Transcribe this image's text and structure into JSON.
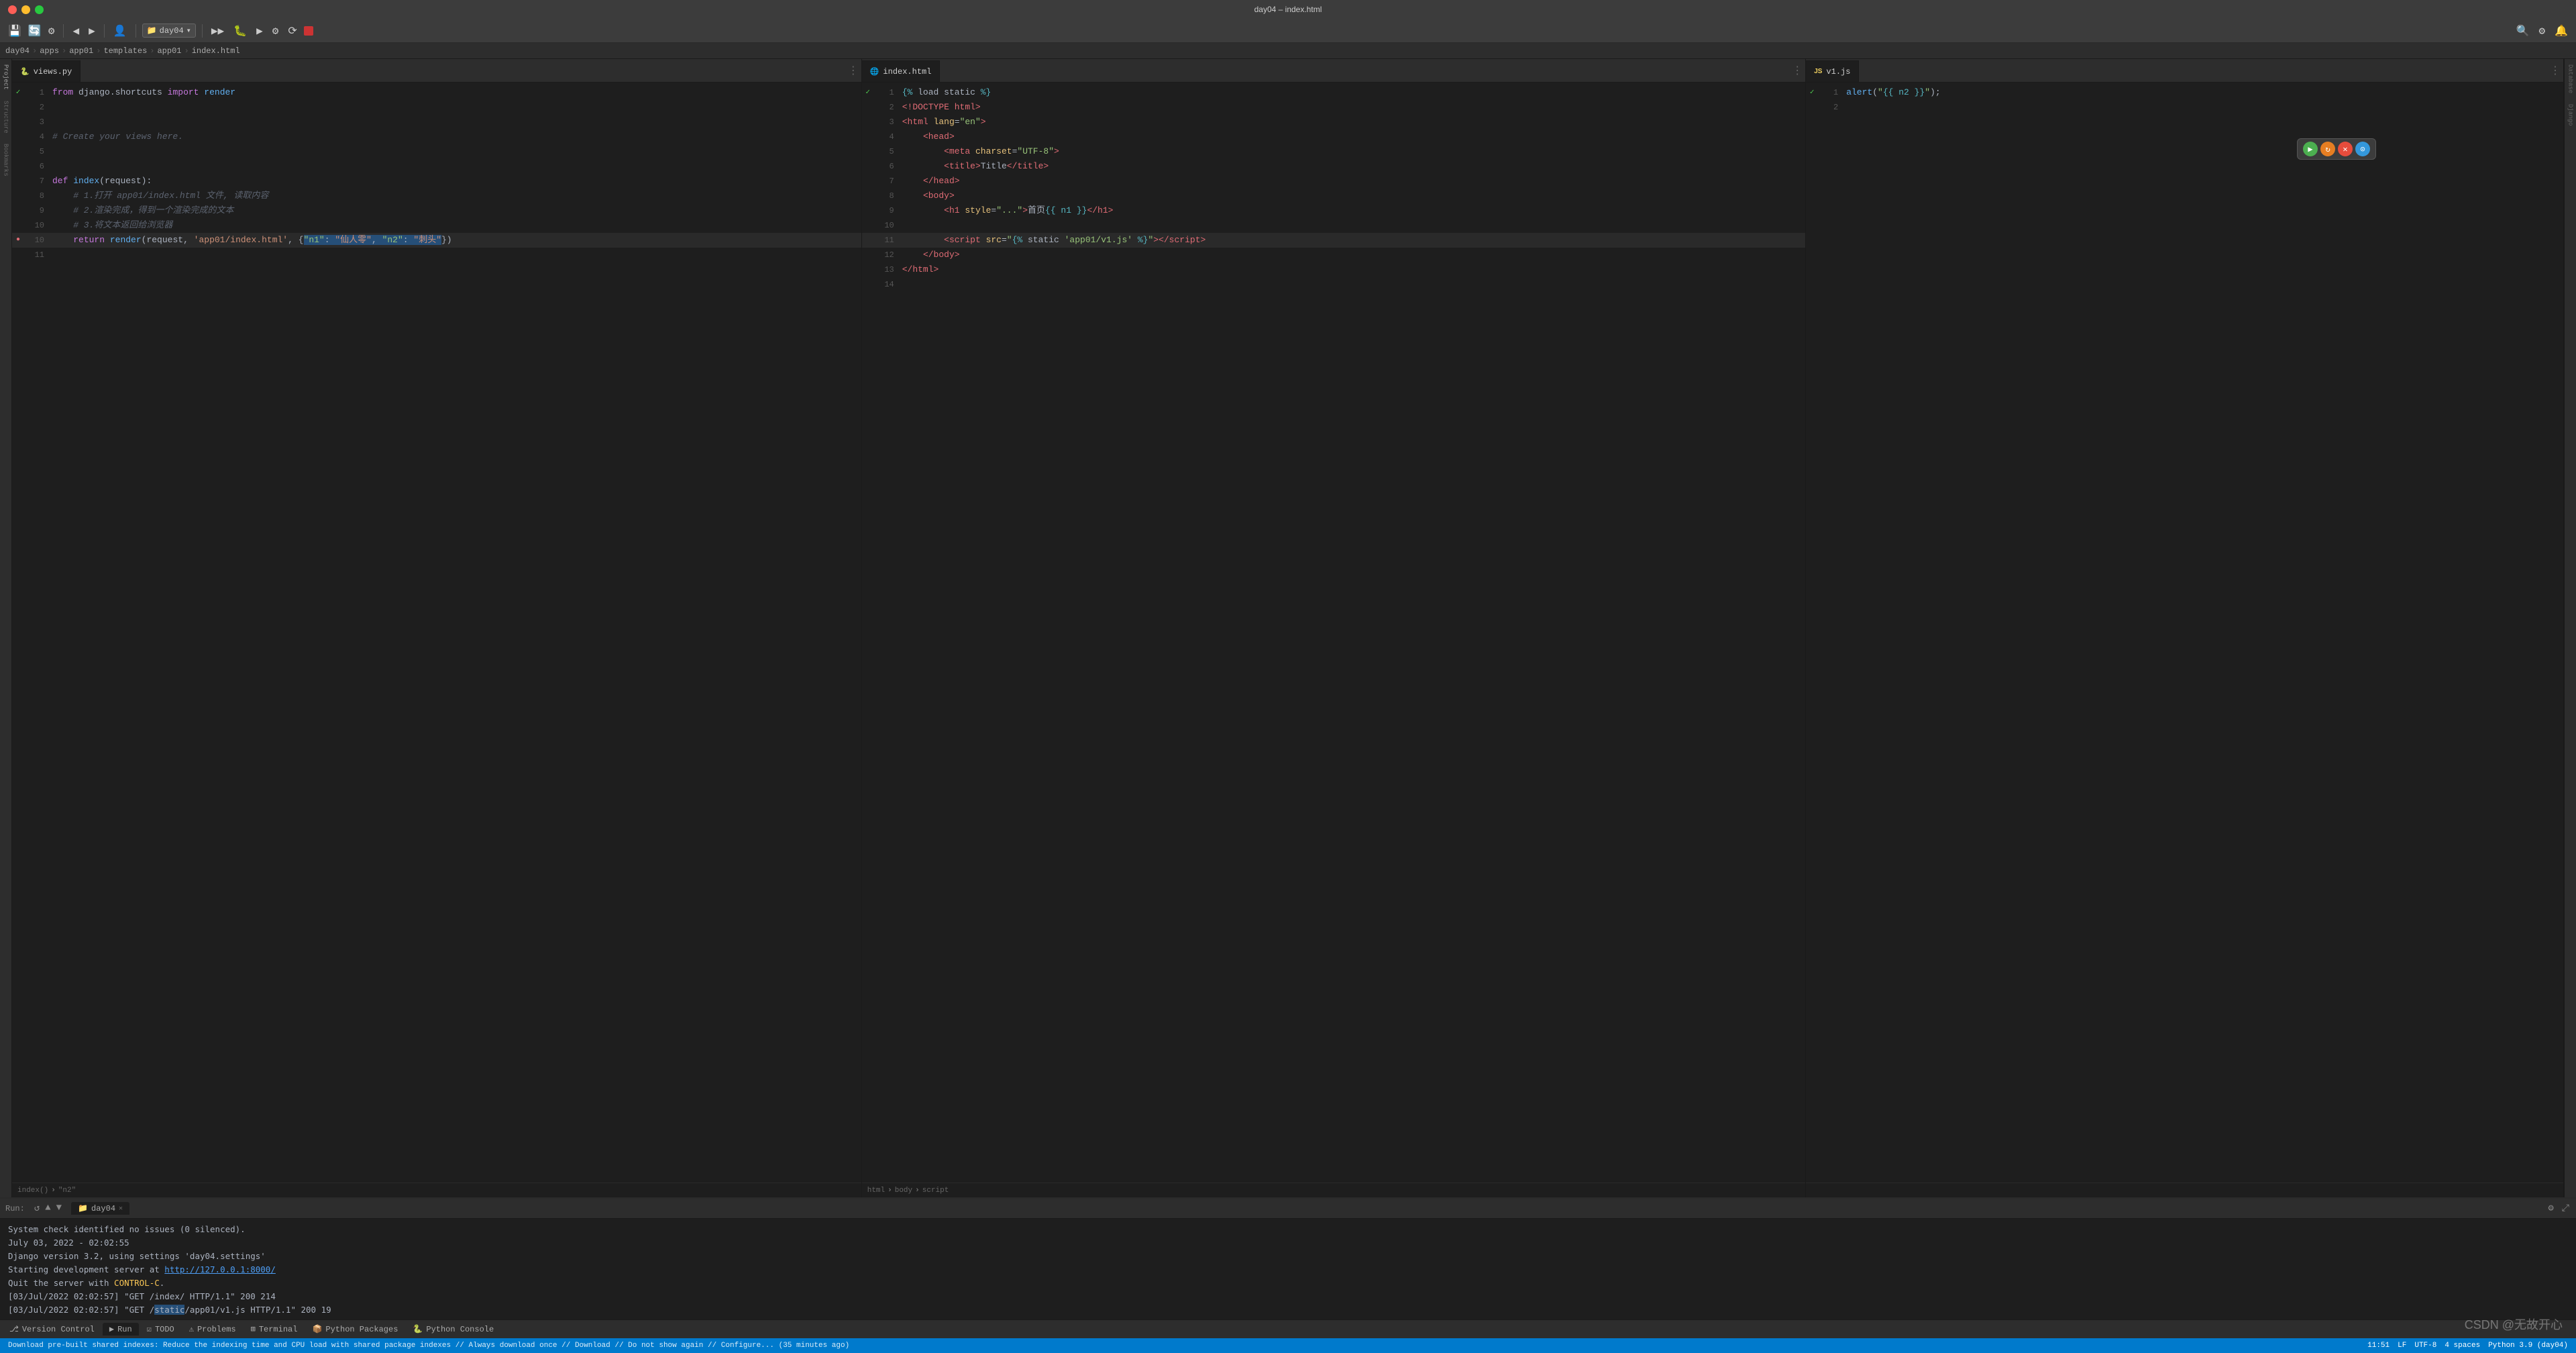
{
  "window": {
    "title": "day04 – index.html"
  },
  "toolbar": {
    "project_name": "day04",
    "run_btn": "▶",
    "stop_color": "#cc3333"
  },
  "breadcrumb": {
    "items": [
      "day04",
      "apps",
      "app01",
      "templates",
      "app01",
      "index.html"
    ]
  },
  "left_panel": {
    "tab": {
      "filename": "views.py",
      "icon": "🐍"
    },
    "lines": [
      {
        "num": 1,
        "content": "from django.shortcuts import render",
        "has_check": true
      },
      {
        "num": 2,
        "content": ""
      },
      {
        "num": 3,
        "content": ""
      },
      {
        "num": 4,
        "content": "# Create your views here."
      },
      {
        "num": 5,
        "content": ""
      },
      {
        "num": 6,
        "content": ""
      },
      {
        "num": 7,
        "content": "def index(request):"
      },
      {
        "num": 8,
        "content": "    # 1.打开 app01/index.html 文件, 读取内容"
      },
      {
        "num": 9,
        "content": "    # 2.渲染完成，得到一个渲染完成的文本"
      },
      {
        "num": 10,
        "content": "    # 3.将文本返回给浏览器"
      },
      {
        "num": 11,
        "content": "    return render(request, 'app01/index.html', {\"n1\": \"仙人零\", \"n2\": \"刺头\"})",
        "is_highlighted": true,
        "has_debug_icon": true
      }
    ],
    "status": [
      "index()",
      "\"n2\""
    ]
  },
  "middle_panel": {
    "tab": {
      "filename": "index.html",
      "icon": "🌐"
    },
    "lines": [
      {
        "num": 1,
        "content": "{% load static %}",
        "has_check": true
      },
      {
        "num": 2,
        "content": "<!DOCTYPE html>"
      },
      {
        "num": 3,
        "content": "<html lang=\"en\">"
      },
      {
        "num": 4,
        "content": "    <head>"
      },
      {
        "num": 5,
        "content": "        <meta charset=\"UTF-8\">"
      },
      {
        "num": 6,
        "content": "        <title>Title</title>"
      },
      {
        "num": 7,
        "content": "    </head>"
      },
      {
        "num": 8,
        "content": "    <body>"
      },
      {
        "num": 9,
        "content": "        <h1 style=\"...\">首页{{ n1 }}</h1>"
      },
      {
        "num": 10,
        "content": ""
      },
      {
        "num": 11,
        "content": "        <script src=\"{% static 'app01/v1.js' %}\"></script>",
        "is_highlighted": true
      },
      {
        "num": 12,
        "content": "    </body>"
      },
      {
        "num": 13,
        "content": "</html>"
      },
      {
        "num": 14,
        "content": ""
      }
    ],
    "status": [
      "html",
      "body",
      "script"
    ]
  },
  "right_panel": {
    "tab": {
      "filename": "v1.js",
      "icon": "JS"
    },
    "lines": [
      {
        "num": 1,
        "content": "alert(\"{{ n2 }}\");",
        "has_check": true
      },
      {
        "num": 2,
        "content": ""
      }
    ]
  },
  "debug_toolbar": {
    "buttons": [
      "green",
      "orange",
      "red",
      "blue"
    ]
  },
  "bottom_panel": {
    "run_label": "Run:",
    "run_tab": "day04",
    "output": [
      {
        "text": "System check identified no issues (0 silenced)."
      },
      {
        "text": "July 03, 2022 - 02:02:55"
      },
      {
        "text": "Django version 3.2, using settings 'day04.settings'"
      },
      {
        "text": "Starting development server at ",
        "link": "http://127.0.0.1:8000/",
        "link_text": "http://127.0.0.1:8000/"
      },
      {
        "text": "Quit the server with CONTROL-C."
      },
      {
        "text": "[03/Jul/2022 02:02:57] \"GET /index/ HTTP/1.1\" 200 214"
      },
      {
        "text": "[03/Jul/2022 02:02:57] \"GET /",
        "highlight": "static",
        "rest": "/app01/v1.js HTTP/1.1\" 200 19"
      }
    ]
  },
  "bottom_tabs": [
    {
      "label": "Version Control",
      "icon": "⎇"
    },
    {
      "label": "Run",
      "icon": "▶"
    },
    {
      "label": "TODO",
      "icon": "☑"
    },
    {
      "label": "Problems",
      "icon": "⚠"
    },
    {
      "label": "Terminal",
      "icon": "⊞"
    },
    {
      "label": "Python Packages",
      "icon": "📦"
    },
    {
      "label": "Python Console",
      "icon": "🐍"
    }
  ],
  "status_bar": {
    "left": "Download pre-built shared indexes: Reduce the indexing time and CPU load with shared package indexes // Always download once // Download // Do not show again // Configure... (35 minutes ago)",
    "right_items": [
      "11:51",
      "LF",
      "UTF-8",
      "4 spaces",
      "Python 3.9 (day04)"
    ]
  },
  "watermark": "CSDN @无故开心",
  "sidebar_left_labels": [
    "Project",
    "Structure",
    "Bookmarks"
  ],
  "sidebar_right_labels": [
    "Database",
    "Django Structure"
  ]
}
